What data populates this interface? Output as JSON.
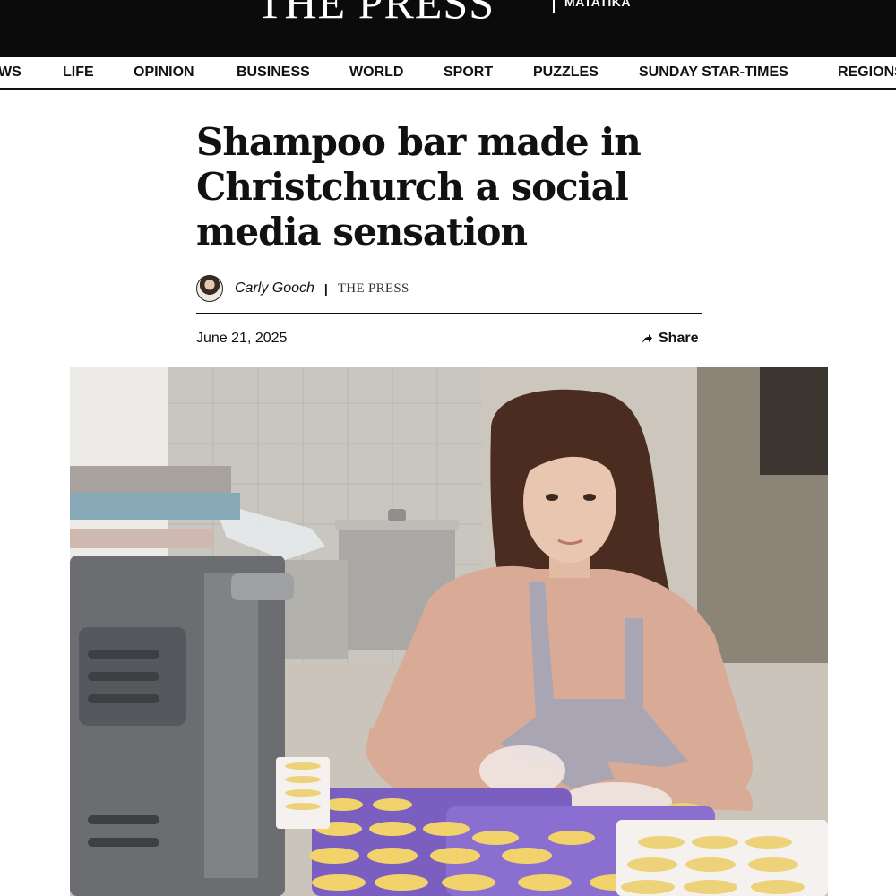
{
  "masthead": {
    "logo_text": "THE PRESS",
    "logo_subtitle": "MATATIKA"
  },
  "nav": {
    "items": [
      "WS",
      "LIFE",
      "OPINION",
      "BUSINESS",
      "WORLD",
      "SPORT",
      "PUZZLES",
      "SUNDAY STAR-TIMES",
      "REGIONS"
    ]
  },
  "article": {
    "headline": "Shampoo bar made in Christchurch a social media sensation",
    "author": "Carly Gooch",
    "byline_separator": "|",
    "publication": "THE PRESS",
    "date": "June 21, 2025",
    "share_label": "Share",
    "share_icon": "share-arrow-icon"
  },
  "photo": {
    "subject": "woman-at-soap-workbench"
  },
  "colors": {
    "masthead_bg": "#0b0b0b",
    "text": "#111111",
    "mould_purple": "#7b5fc0",
    "soap_yellow": "#f2d36b"
  }
}
